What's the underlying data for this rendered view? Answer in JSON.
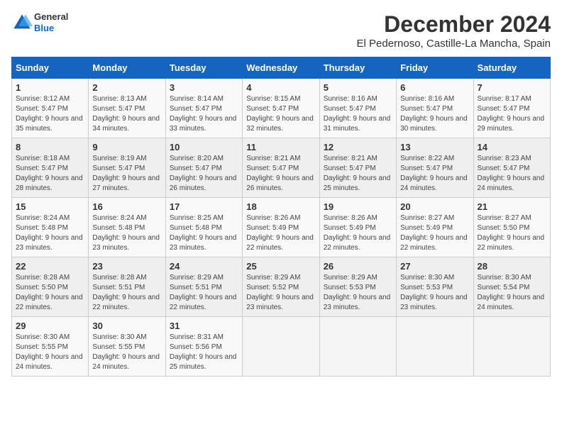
{
  "logo": {
    "general": "General",
    "blue": "Blue"
  },
  "header": {
    "month_title": "December 2024",
    "location": "El Pedernoso, Castille-La Mancha, Spain"
  },
  "calendar": {
    "weekdays": [
      "Sunday",
      "Monday",
      "Tuesday",
      "Wednesday",
      "Thursday",
      "Friday",
      "Saturday"
    ],
    "weeks": [
      [
        {
          "day": "1",
          "sunrise": "Sunrise: 8:12 AM",
          "sunset": "Sunset: 5:47 PM",
          "daylight": "Daylight: 9 hours and 35 minutes."
        },
        {
          "day": "2",
          "sunrise": "Sunrise: 8:13 AM",
          "sunset": "Sunset: 5:47 PM",
          "daylight": "Daylight: 9 hours and 34 minutes."
        },
        {
          "day": "3",
          "sunrise": "Sunrise: 8:14 AM",
          "sunset": "Sunset: 5:47 PM",
          "daylight": "Daylight: 9 hours and 33 minutes."
        },
        {
          "day": "4",
          "sunrise": "Sunrise: 8:15 AM",
          "sunset": "Sunset: 5:47 PM",
          "daylight": "Daylight: 9 hours and 32 minutes."
        },
        {
          "day": "5",
          "sunrise": "Sunrise: 8:16 AM",
          "sunset": "Sunset: 5:47 PM",
          "daylight": "Daylight: 9 hours and 31 minutes."
        },
        {
          "day": "6",
          "sunrise": "Sunrise: 8:16 AM",
          "sunset": "Sunset: 5:47 PM",
          "daylight": "Daylight: 9 hours and 30 minutes."
        },
        {
          "day": "7",
          "sunrise": "Sunrise: 8:17 AM",
          "sunset": "Sunset: 5:47 PM",
          "daylight": "Daylight: 9 hours and 29 minutes."
        }
      ],
      [
        {
          "day": "8",
          "sunrise": "Sunrise: 8:18 AM",
          "sunset": "Sunset: 5:47 PM",
          "daylight": "Daylight: 9 hours and 28 minutes."
        },
        {
          "day": "9",
          "sunrise": "Sunrise: 8:19 AM",
          "sunset": "Sunset: 5:47 PM",
          "daylight": "Daylight: 9 hours and 27 minutes."
        },
        {
          "day": "10",
          "sunrise": "Sunrise: 8:20 AM",
          "sunset": "Sunset: 5:47 PM",
          "daylight": "Daylight: 9 hours and 26 minutes."
        },
        {
          "day": "11",
          "sunrise": "Sunrise: 8:21 AM",
          "sunset": "Sunset: 5:47 PM",
          "daylight": "Daylight: 9 hours and 26 minutes."
        },
        {
          "day": "12",
          "sunrise": "Sunrise: 8:21 AM",
          "sunset": "Sunset: 5:47 PM",
          "daylight": "Daylight: 9 hours and 25 minutes."
        },
        {
          "day": "13",
          "sunrise": "Sunrise: 8:22 AM",
          "sunset": "Sunset: 5:47 PM",
          "daylight": "Daylight: 9 hours and 24 minutes."
        },
        {
          "day": "14",
          "sunrise": "Sunrise: 8:23 AM",
          "sunset": "Sunset: 5:47 PM",
          "daylight": "Daylight: 9 hours and 24 minutes."
        }
      ],
      [
        {
          "day": "15",
          "sunrise": "Sunrise: 8:24 AM",
          "sunset": "Sunset: 5:48 PM",
          "daylight": "Daylight: 9 hours and 23 minutes."
        },
        {
          "day": "16",
          "sunrise": "Sunrise: 8:24 AM",
          "sunset": "Sunset: 5:48 PM",
          "daylight": "Daylight: 9 hours and 23 minutes."
        },
        {
          "day": "17",
          "sunrise": "Sunrise: 8:25 AM",
          "sunset": "Sunset: 5:48 PM",
          "daylight": "Daylight: 9 hours and 23 minutes."
        },
        {
          "day": "18",
          "sunrise": "Sunrise: 8:26 AM",
          "sunset": "Sunset: 5:49 PM",
          "daylight": "Daylight: 9 hours and 22 minutes."
        },
        {
          "day": "19",
          "sunrise": "Sunrise: 8:26 AM",
          "sunset": "Sunset: 5:49 PM",
          "daylight": "Daylight: 9 hours and 22 minutes."
        },
        {
          "day": "20",
          "sunrise": "Sunrise: 8:27 AM",
          "sunset": "Sunset: 5:49 PM",
          "daylight": "Daylight: 9 hours and 22 minutes."
        },
        {
          "day": "21",
          "sunrise": "Sunrise: 8:27 AM",
          "sunset": "Sunset: 5:50 PM",
          "daylight": "Daylight: 9 hours and 22 minutes."
        }
      ],
      [
        {
          "day": "22",
          "sunrise": "Sunrise: 8:28 AM",
          "sunset": "Sunset: 5:50 PM",
          "daylight": "Daylight: 9 hours and 22 minutes."
        },
        {
          "day": "23",
          "sunrise": "Sunrise: 8:28 AM",
          "sunset": "Sunset: 5:51 PM",
          "daylight": "Daylight: 9 hours and 22 minutes."
        },
        {
          "day": "24",
          "sunrise": "Sunrise: 8:29 AM",
          "sunset": "Sunset: 5:51 PM",
          "daylight": "Daylight: 9 hours and 22 minutes."
        },
        {
          "day": "25",
          "sunrise": "Sunrise: 8:29 AM",
          "sunset": "Sunset: 5:52 PM",
          "daylight": "Daylight: 9 hours and 23 minutes."
        },
        {
          "day": "26",
          "sunrise": "Sunrise: 8:29 AM",
          "sunset": "Sunset: 5:53 PM",
          "daylight": "Daylight: 9 hours and 23 minutes."
        },
        {
          "day": "27",
          "sunrise": "Sunrise: 8:30 AM",
          "sunset": "Sunset: 5:53 PM",
          "daylight": "Daylight: 9 hours and 23 minutes."
        },
        {
          "day": "28",
          "sunrise": "Sunrise: 8:30 AM",
          "sunset": "Sunset: 5:54 PM",
          "daylight": "Daylight: 9 hours and 24 minutes."
        }
      ],
      [
        {
          "day": "29",
          "sunrise": "Sunrise: 8:30 AM",
          "sunset": "Sunset: 5:55 PM",
          "daylight": "Daylight: 9 hours and 24 minutes."
        },
        {
          "day": "30",
          "sunrise": "Sunrise: 8:30 AM",
          "sunset": "Sunset: 5:55 PM",
          "daylight": "Daylight: 9 hours and 24 minutes."
        },
        {
          "day": "31",
          "sunrise": "Sunrise: 8:31 AM",
          "sunset": "Sunset: 5:56 PM",
          "daylight": "Daylight: 9 hours and 25 minutes."
        },
        null,
        null,
        null,
        null
      ]
    ]
  }
}
